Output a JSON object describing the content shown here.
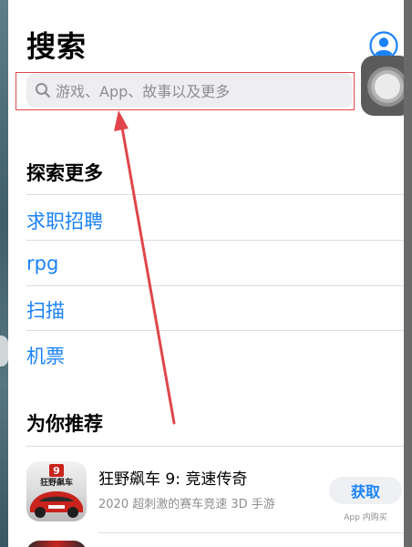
{
  "header": {
    "title": "搜索"
  },
  "search": {
    "placeholder": "游戏、App、故事以及更多"
  },
  "explore": {
    "title": "探索更多",
    "items": [
      {
        "label": "求职招聘"
      },
      {
        "label": "rpg"
      },
      {
        "label": "扫描"
      },
      {
        "label": "机票"
      }
    ]
  },
  "recommend": {
    "title": "为你推荐",
    "app": {
      "name": "狂野飙车 9: 竞速传奇",
      "subtitle": "2020 超刺激的赛车竞速 3D 手游",
      "get_label": "获取",
      "iap_note": "App 内购买",
      "icon_badge": "9",
      "icon_text": "狂野飙车"
    }
  },
  "colors": {
    "accent": "#1a82f7",
    "annotation": "#e0464b"
  }
}
